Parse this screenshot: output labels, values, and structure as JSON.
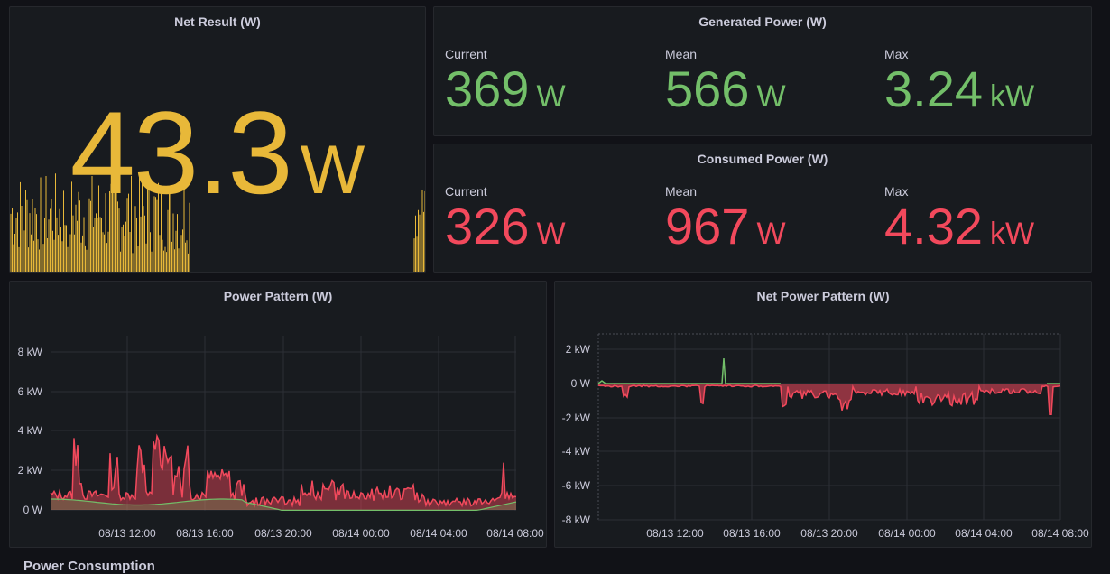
{
  "net_result": {
    "title": "Net Result (W)",
    "value": "43.3",
    "unit": "W",
    "color": "#e8b839"
  },
  "generated": {
    "title": "Generated Power (W)",
    "color": "#73bf69",
    "stats": [
      {
        "label": "Current",
        "value": "369",
        "unit": "W"
      },
      {
        "label": "Mean",
        "value": "566",
        "unit": "W"
      },
      {
        "label": "Max",
        "value": "3.24",
        "unit": "kW"
      }
    ]
  },
  "consumed": {
    "title": "Consumed Power (W)",
    "color": "#f2495c",
    "stats": [
      {
        "label": "Current",
        "value": "326",
        "unit": "W"
      },
      {
        "label": "Mean",
        "value": "967",
        "unit": "W"
      },
      {
        "label": "Max",
        "value": "4.32",
        "unit": "kW"
      }
    ]
  },
  "power_pattern": {
    "title": "Power Pattern (W)",
    "y_ticks": [
      "8 kW",
      "6 kW",
      "4 kW",
      "2 kW",
      "0 W"
    ],
    "x_ticks": [
      "08/13 12:00",
      "08/13 16:00",
      "08/13 20:00",
      "08/14 00:00",
      "08/14 04:00",
      "08/14 08:00"
    ]
  },
  "net_power_pattern": {
    "title": "Net Power Pattern (W)",
    "y_ticks": [
      "2 kW",
      "0 W",
      "-2 kW",
      "-4 kW",
      "-6 kW",
      "-8 kW"
    ],
    "x_ticks": [
      "08/13 12:00",
      "08/13 16:00",
      "08/13 20:00",
      "08/14 00:00",
      "08/14 04:00",
      "08/14 08:00"
    ]
  },
  "next_row_title": "Power Consumption"
}
